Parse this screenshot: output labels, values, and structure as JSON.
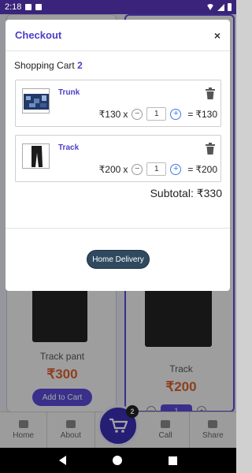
{
  "status_bar": {
    "time": "2:18"
  },
  "modal": {
    "title": "Checkout",
    "close_label": "×",
    "cart_label": "Shopping Cart",
    "cart_count": "2",
    "items": [
      {
        "name": "Trunk",
        "unit_price": "₹130",
        "times": "x",
        "quantity": "1",
        "equals": "=",
        "total": "₹130",
        "minus": "−",
        "plus": "+"
      },
      {
        "name": "Track",
        "unit_price": "₹200",
        "times": "x",
        "quantity": "1",
        "equals": "=",
        "total": "₹200",
        "minus": "−",
        "plus": "+"
      }
    ],
    "subtotal_label": "Subtotal:",
    "subtotal_value": "₹330",
    "action_button": "Home Delivery"
  },
  "background": {
    "products": [
      {
        "name": "Track pant",
        "price": "₹300",
        "button": "Add to Cart"
      },
      {
        "name": "Track",
        "price": "₹200",
        "quantity": "1",
        "minus": "−",
        "plus": "+"
      }
    ],
    "cart_badge": "2",
    "nav": [
      {
        "label": "Home",
        "icon": "home-icon"
      },
      {
        "label": "About",
        "icon": "info-icon"
      },
      {
        "label": "Call",
        "icon": "phone-icon"
      },
      {
        "label": "Share",
        "icon": "share-icon"
      }
    ]
  }
}
